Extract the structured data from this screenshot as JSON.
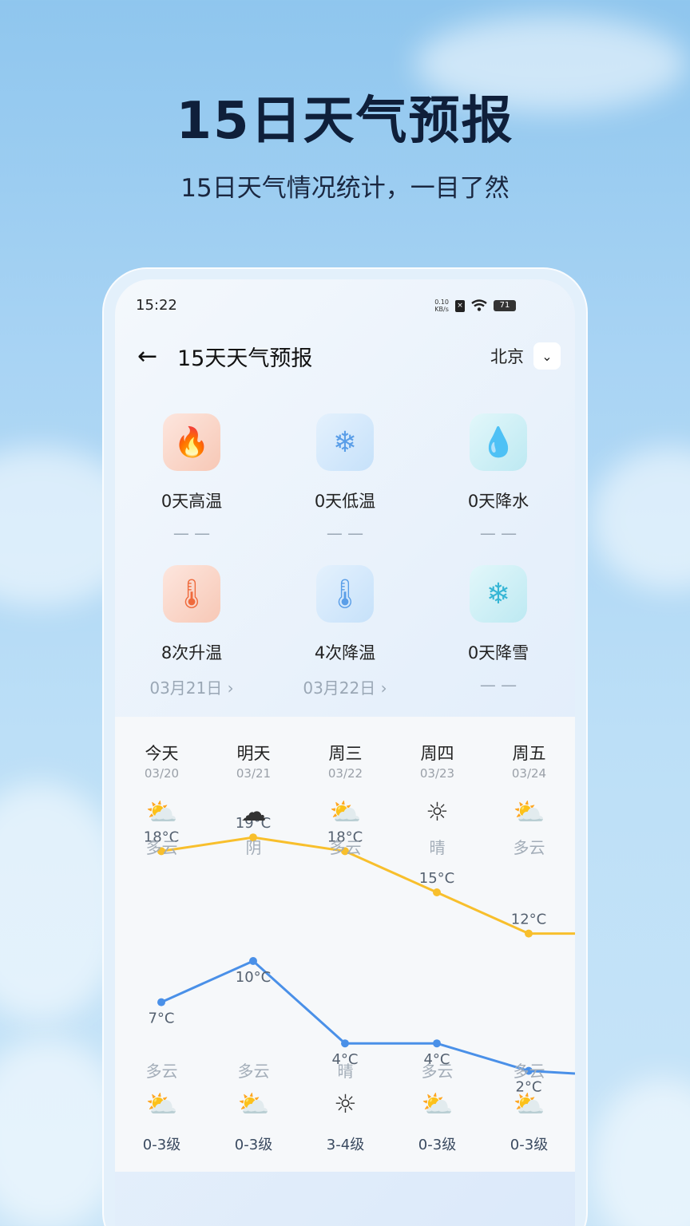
{
  "hero": {
    "title": "15日天气预报",
    "subtitle": "15日天气情况统计，一目了然"
  },
  "status_bar": {
    "time": "15:22",
    "net_speed_top": "0.10",
    "net_speed_bottom": "KB/s",
    "battery": "71"
  },
  "header": {
    "back_icon": "arrow-left-icon",
    "title": "15天天气预报",
    "city": "北京",
    "city_dropdown_icon": "chevron-down-icon"
  },
  "stats": [
    {
      "icon": "flame-icon",
      "label": "0天高温",
      "sub": "— —"
    },
    {
      "icon": "thermometer-cold-icon",
      "label": "0天低温",
      "sub": "— —"
    },
    {
      "icon": "water-drop-icon",
      "label": "0天降水",
      "sub": "— —"
    },
    {
      "icon": "thermometer-rise-icon",
      "label": "8次升温",
      "sub": "03月21日 ›"
    },
    {
      "icon": "thermometer-fall-icon",
      "label": "4次降温",
      "sub": "03月22日 ›"
    },
    {
      "icon": "snowflake-icon",
      "label": "0天降雪",
      "sub": "— —"
    }
  ],
  "days": [
    {
      "day": "今天",
      "date": "03/20",
      "day_weather": "多云",
      "day_icon": "partly-cloudy-icon",
      "night_weather": "多云",
      "night_icon": "partly-cloudy-icon",
      "high": "18°C",
      "low": "7°C",
      "wind": "0-3级"
    },
    {
      "day": "明天",
      "date": "03/21",
      "day_weather": "阴",
      "day_icon": "overcast-icon",
      "night_weather": "多云",
      "night_icon": "partly-cloudy-icon",
      "high": "19°C",
      "low": "10°C",
      "wind": "0-3级"
    },
    {
      "day": "周三",
      "date": "03/22",
      "day_weather": "多云",
      "day_icon": "partly-cloudy-icon",
      "night_weather": "晴",
      "night_icon": "sunny-icon",
      "high": "18°C",
      "low": "4°C",
      "wind": "3-4级"
    },
    {
      "day": "周四",
      "date": "03/23",
      "day_weather": "晴",
      "day_icon": "sunny-icon",
      "night_weather": "多云",
      "night_icon": "partly-cloudy-icon",
      "high": "15°C",
      "low": "4°C",
      "wind": "0-3级"
    },
    {
      "day": "周五",
      "date": "03/24",
      "day_weather": "多云",
      "day_icon": "partly-cloudy-icon",
      "night_weather": "多云",
      "night_icon": "partly-cloudy-icon",
      "high": "12°C",
      "low": "2°C",
      "wind": "0-3级"
    }
  ],
  "chart_data": {
    "type": "line",
    "x": [
      "03/20",
      "03/21",
      "03/22",
      "03/23",
      "03/24"
    ],
    "series": [
      {
        "values": [
          18,
          19,
          18,
          15,
          12
        ],
        "color": "#f8bf2c"
      },
      {
        "values": [
          7,
          10,
          4,
          4,
          2
        ],
        "color": "#4a90e8"
      }
    ]
  }
}
